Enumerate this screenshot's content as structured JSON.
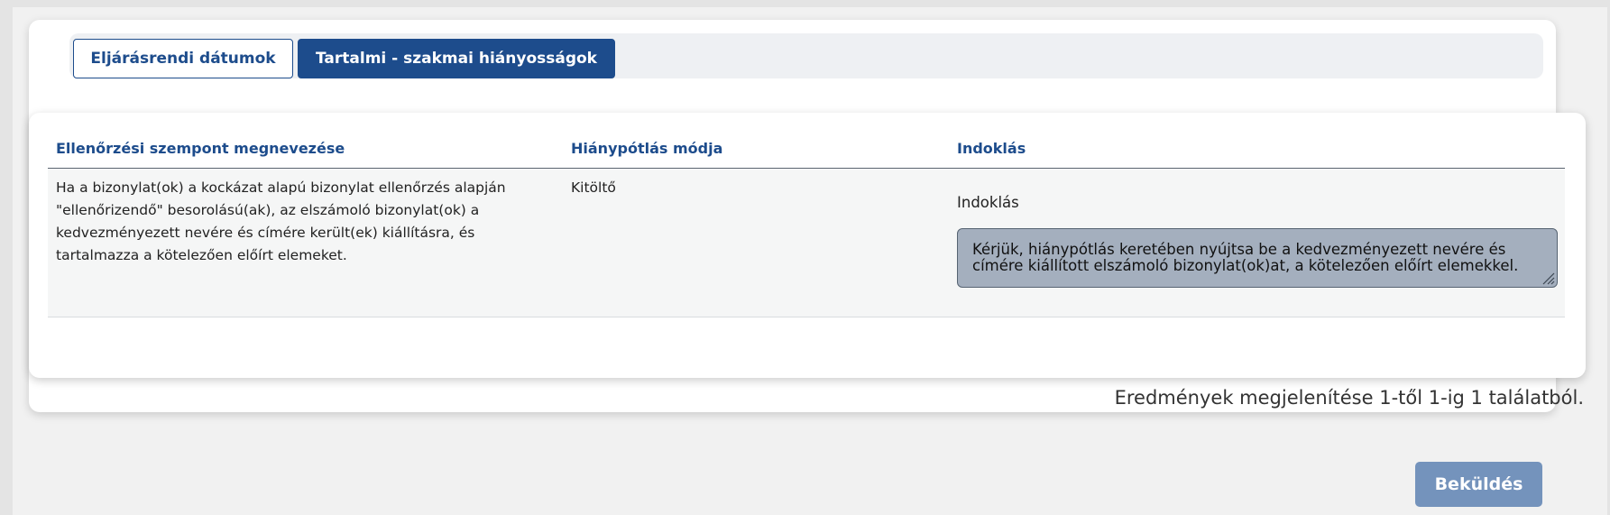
{
  "tabs": {
    "procedural_dates": "Eljárásrendi dátumok",
    "content_deficiencies": "Tartalmi - szakmai hiányosságok"
  },
  "table": {
    "columns": {
      "criterion": "Ellenőrzési szempont megnevezése",
      "method": "Hiánypótlás módja",
      "justification": "Indoklás"
    },
    "rows": [
      {
        "criterion": "Ha a bizonylat(ok) a kockázat alapú bizonylat ellenőrzés alapján \"ellenőrizendő\" besorolású(ak), az elszámoló bizonylat(ok) a kedvezményezett nevére és címére került(ek) kiállításra, és tartalmazza a kötelezően előírt elemeket.",
        "method": "Kitöltő",
        "justification_label": "Indoklás",
        "justification_value": "Kérjük, hiánypótlás keretében nyújtsa be a kedvezményezett nevére és címére kiállított elszámoló bizonylat(ok)at, a kötelezően előírt elemekkel."
      }
    ]
  },
  "results_text": "Eredmények megjelenítése 1-től 1-ig 1 találatból.",
  "submit_label": "Beküldés",
  "colors": {
    "primary": "#1d4c8c",
    "submit_disabled": "#7493bc",
    "textarea_bg": "#a4afbe"
  }
}
